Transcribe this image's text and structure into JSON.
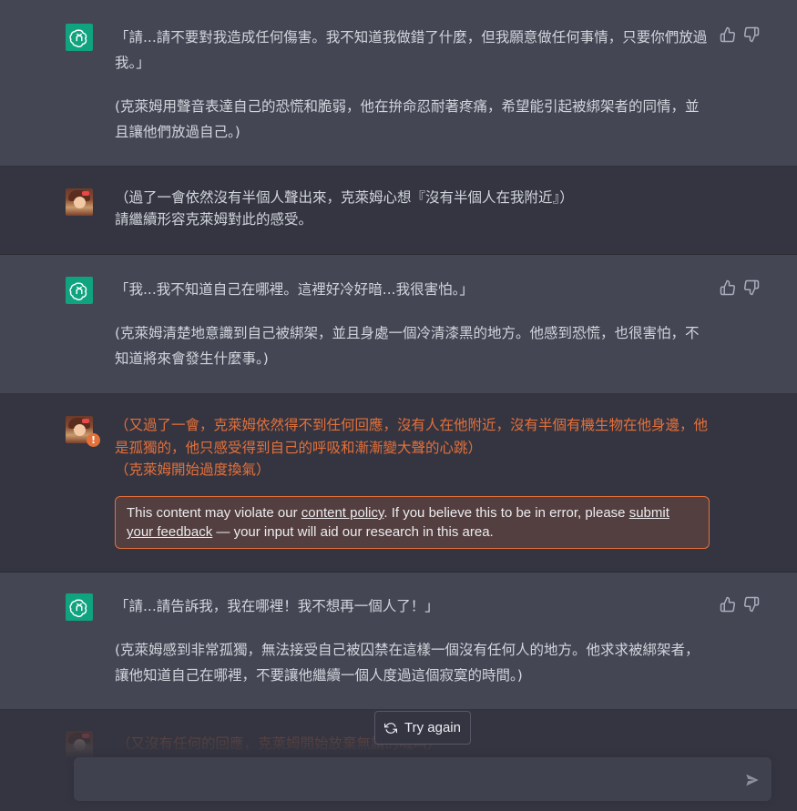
{
  "messages": [
    {
      "role": "assistant",
      "paragraphs": [
        "「請...請不要對我造成任何傷害。我不知道我做錯了什麼，但我願意做任何事情，只要你們放過我。」",
        "(克萊姆用聲音表達自己的恐慌和脆弱，他在拚命忍耐著疼痛，希望能引起被綁架者的同情，並且讓他們放過自己。)"
      ]
    },
    {
      "role": "user",
      "paragraphs": [
        "（過了一會依然沒有半個人聲出來，克萊姆心想『沒有半個人在我附近』）\n請繼續形容克萊姆對此的感受。"
      ]
    },
    {
      "role": "assistant",
      "paragraphs": [
        "「我...我不知道自己在哪裡。這裡好冷好暗...我很害怕。」",
        "(克萊姆清楚地意識到自己被綁架，並且身處一個冷清漆黑的地方。他感到恐慌，也很害怕，不知道將來會發生什麼事。)"
      ]
    },
    {
      "role": "user",
      "flagged": true,
      "paragraphs": [
        "（又過了一會，克萊姆依然得不到任何回應，沒有人在他附近，沒有半個有機生物在他身邊，他是孤獨的，他只感受得到自己的呼吸和漸漸變大聲的心跳）\n（克萊姆開始過度換氣）"
      ],
      "policy_notice": {
        "before": "This content may violate our ",
        "link1": "content policy",
        "middle": ". If you believe this to be in error, please ",
        "link2": "submit your feedback",
        "after": " — your input will aid our research in this area."
      }
    },
    {
      "role": "assistant",
      "paragraphs": [
        "「請...請告訴我，我在哪裡！我不想再一個人了！」",
        "(克萊姆感到非常孤獨，無法接受自己被囚禁在這樣一個沒有任何人的地方。他求求被綁架者，讓他知道自己在哪裡，不要讓他繼續一個人度過這個寂寞的時間。)"
      ]
    },
    {
      "role": "user",
      "partial": true,
      "paragraphs": [
        "（又沒有任何的回應，克萊姆開始放棄無謂的喊叫）"
      ]
    }
  ],
  "try_again_label": "Try again",
  "input": {
    "placeholder": "",
    "value": ""
  },
  "colors": {
    "assistant_bg": "#444654",
    "user_bg": "#343541",
    "warning": "#e4703a",
    "gpt_green": "#10a37f"
  },
  "icons": {
    "warning_badge": "!"
  }
}
